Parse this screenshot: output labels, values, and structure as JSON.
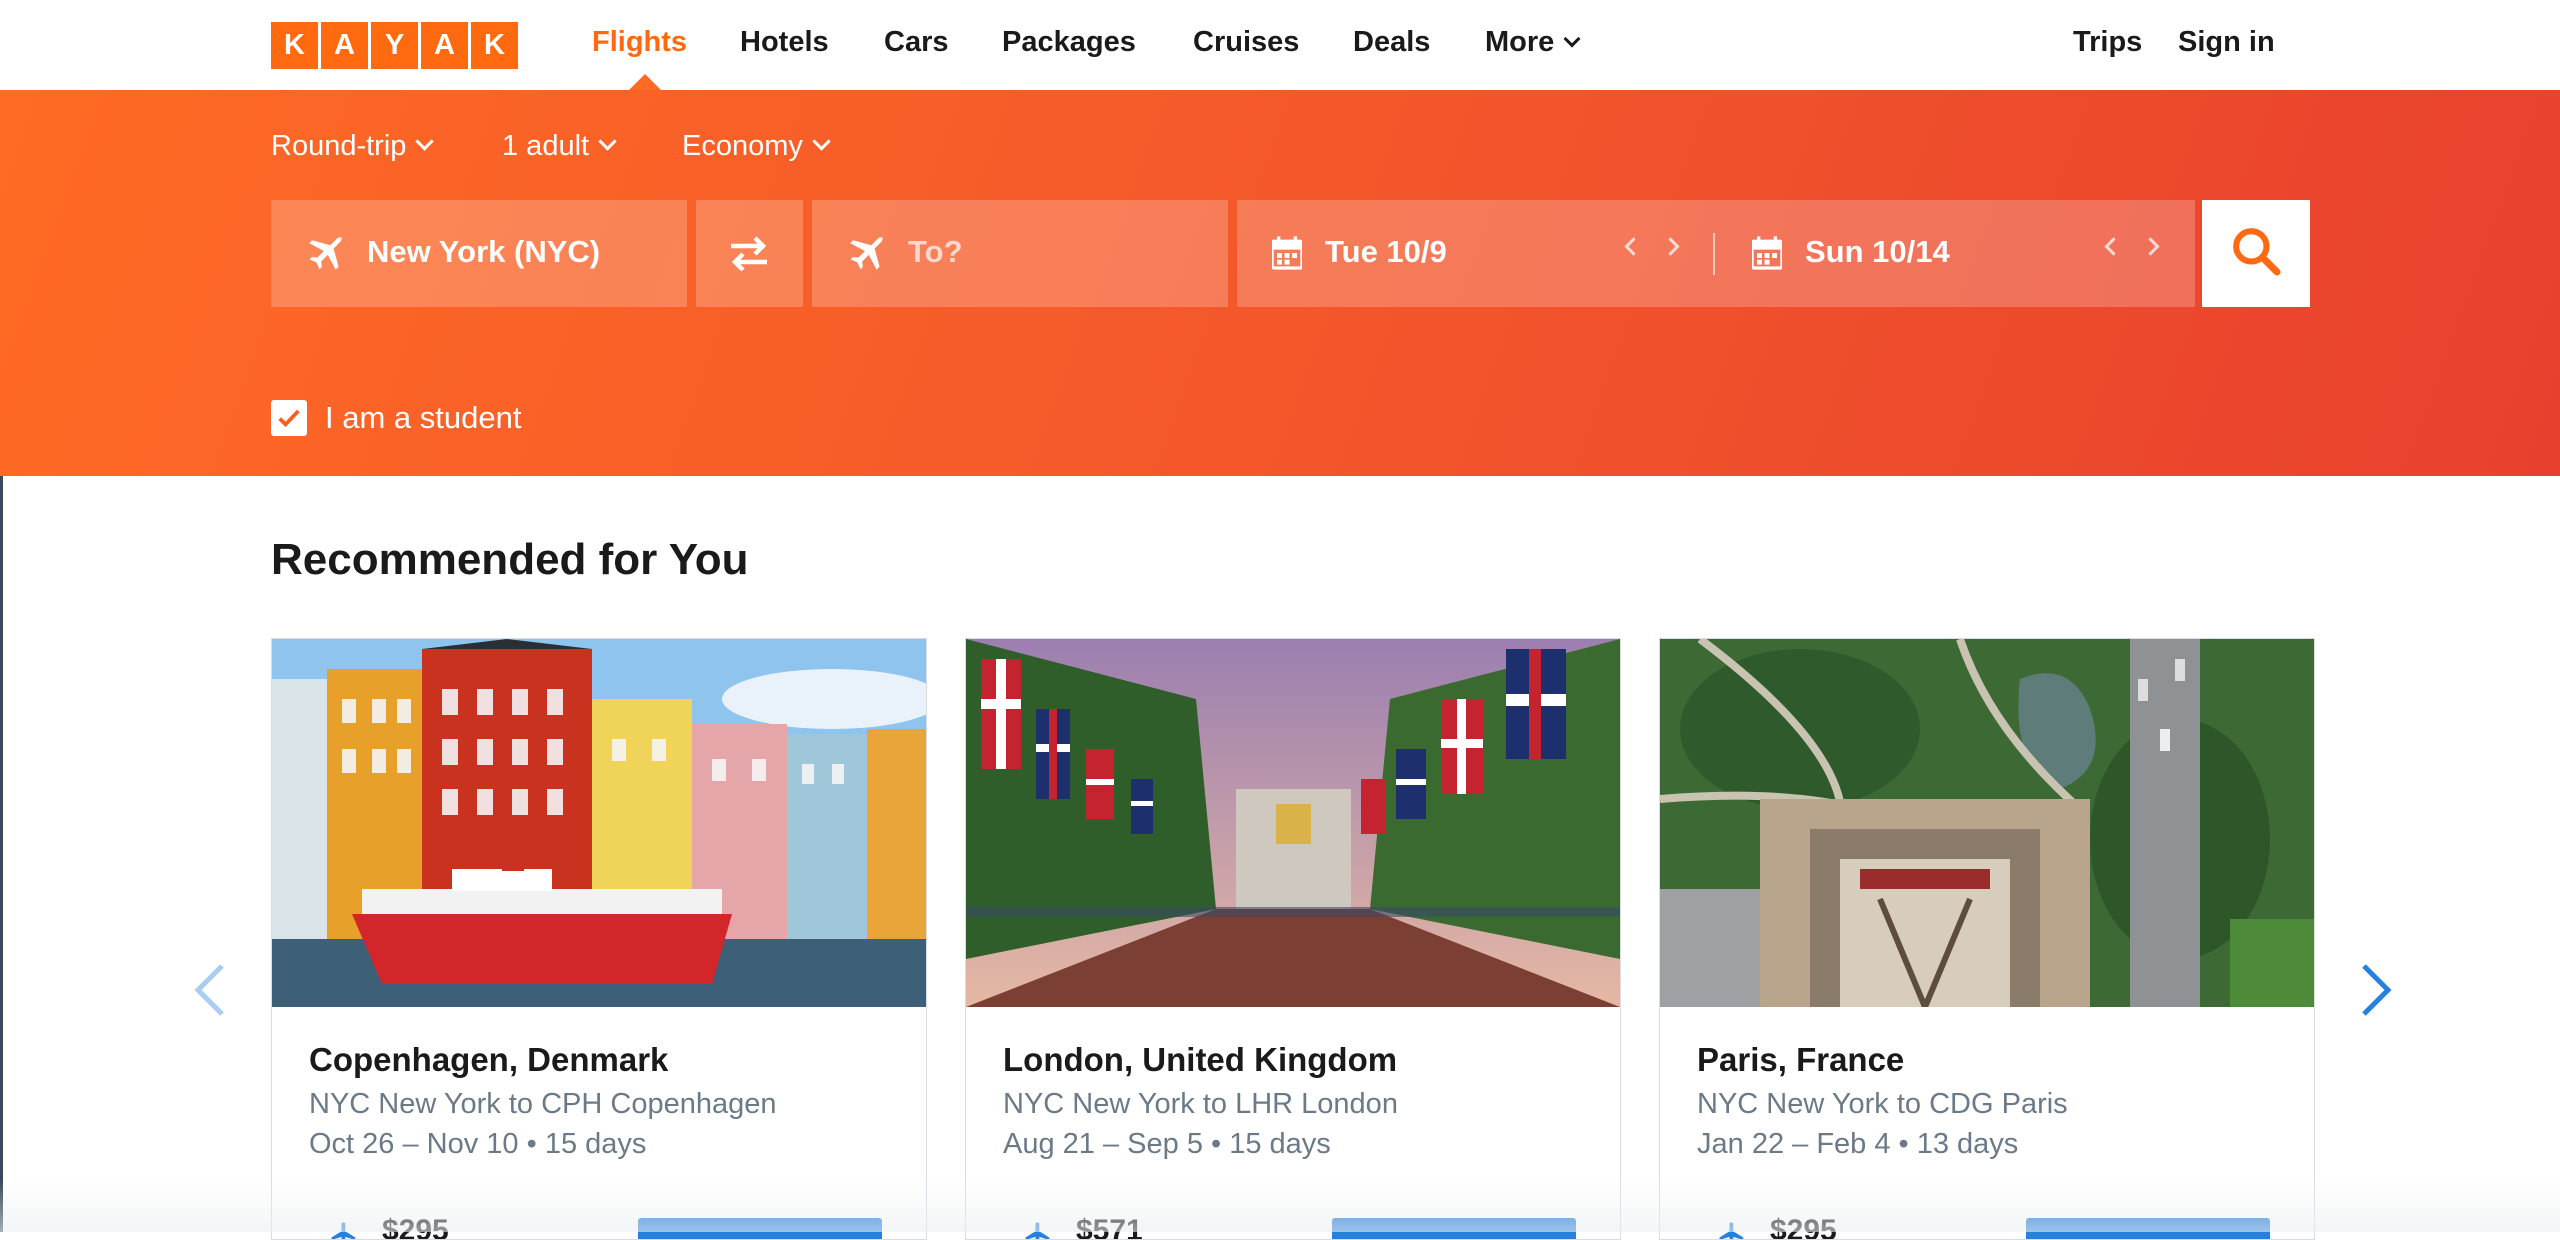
{
  "brand": {
    "letters": [
      "K",
      "A",
      "Y",
      "A",
      "K"
    ],
    "color": "#ff690f"
  },
  "nav": {
    "links": [
      "Flights",
      "Hotels",
      "Cars",
      "Packages",
      "Cruises",
      "Deals",
      "More"
    ],
    "active": "Flights",
    "trips": "Trips",
    "sign_in": "Sign in"
  },
  "search": {
    "trip_type": "Round-trip",
    "travelers": "1 adult",
    "cabin": "Economy",
    "origin": "New York (NYC)",
    "destination_placeholder": "To?",
    "depart_date": "Tue 10/9",
    "return_date": "Sun 10/14",
    "student_label": "I am a student",
    "student_checked": true,
    "icons": {
      "origin": "plane-icon",
      "swap": "swap-icon",
      "destination": "plane-icon",
      "date": "calendar-icon",
      "search": "search-icon"
    }
  },
  "recommendations": {
    "title": "Recommended for You",
    "cards": [
      {
        "destination": "Copenhagen, Denmark",
        "route": "NYC New York to CPH Copenhagen",
        "dates": "Oct 26 – Nov 10 • 15 days",
        "price": "$295"
      },
      {
        "destination": "London, United Kingdom",
        "route": "NYC New York to LHR London",
        "dates": "Aug 21 – Sep 5 • 15 days",
        "price": "$571"
      },
      {
        "destination": "Paris, France",
        "route": "NYC New York to CDG Paris",
        "dates": "Jan 22 – Feb 4 • 13 days",
        "price": "$295"
      }
    ]
  },
  "colors": {
    "accent": "#ff690f",
    "hero_start": "#ff6a24",
    "hero_end": "#e8402e",
    "link_blue": "#2580de"
  }
}
